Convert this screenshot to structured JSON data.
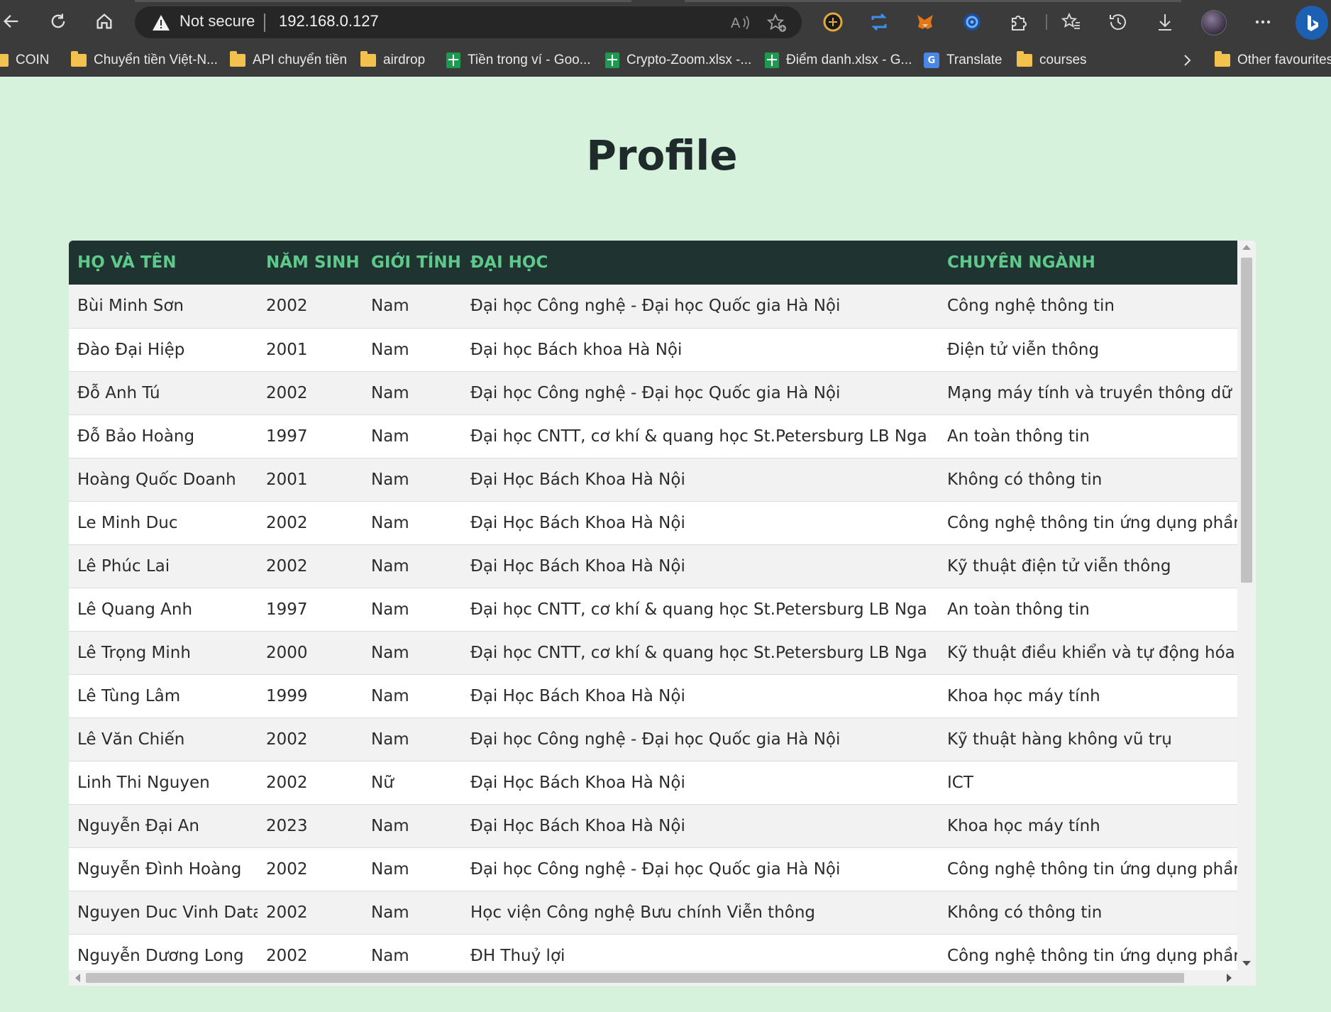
{
  "browser": {
    "security_label": "Not secure",
    "url": "192.168.0.127",
    "bookmarks": [
      {
        "label": "COIN",
        "icon": "folder-icon"
      },
      {
        "label": "Chuyển tiền Việt-N...",
        "icon": "folder-icon"
      },
      {
        "label": "API chuyển tiền",
        "icon": "folder-icon"
      },
      {
        "label": "airdrop",
        "icon": "folder-icon"
      },
      {
        "label": "Tiền trong ví - Goo...",
        "icon": "google-sheets-icon"
      },
      {
        "label": "Crypto-Zoom.xlsx -...",
        "icon": "google-sheets-icon"
      },
      {
        "label": "Điểm danh.xlsx - G...",
        "icon": "google-sheets-icon"
      },
      {
        "label": "Translate",
        "icon": "google-translate-icon"
      },
      {
        "label": "courses",
        "icon": "folder-icon"
      }
    ],
    "other_favourites_label": "Other favourites"
  },
  "page": {
    "title": "Profile"
  },
  "table": {
    "headers": [
      "HỌ VÀ TÊN",
      "NĂM SINH",
      "GIỚI TÍNH",
      "ĐẠI HỌC",
      "CHUYÊN NGÀNH"
    ],
    "rows": [
      [
        "Bùi Minh Sơn",
        "2002",
        "Nam",
        "Đại học Công nghệ - Đại học Quốc gia Hà Nội",
        "Công nghệ thông tin"
      ],
      [
        "Đào Đại Hiệp",
        "2001",
        "Nam",
        "Đại học Bách khoa Hà Nội",
        "Điện tử viễn thông"
      ],
      [
        "Đỗ Anh Tú",
        "2002",
        "Nam",
        "Đại học Công nghệ - Đại học Quốc gia Hà Nội",
        "Mạng máy tính và truyền thông dữ liệu"
      ],
      [
        "Đỗ Bảo Hoàng",
        "1997",
        "Nam",
        "Đại học CNTT, cơ khí & quang học St.Petersburg LB Nga",
        "An toàn thông tin"
      ],
      [
        "Hoàng Quốc Doanh",
        "2001",
        "Nam",
        "Đại Học Bách Khoa Hà Nội",
        "Không có thông tin"
      ],
      [
        "Le Minh Duc",
        "2002",
        "Nam",
        "Đại Học Bách Khoa Hà Nội",
        "Công nghệ thông tin ứng dụng phần mềm"
      ],
      [
        "Lê Phúc Lai",
        "2002",
        "Nam",
        "Đại Học Bách Khoa Hà Nội",
        "Kỹ thuật điện tử viễn thông"
      ],
      [
        "Lê Quang Anh",
        "1997",
        "Nam",
        "Đại học CNTT, cơ khí & quang học St.Petersburg LB Nga",
        "An toàn thông tin"
      ],
      [
        "Lê Trọng Minh",
        "2000",
        "Nam",
        "Đại học CNTT, cơ khí & quang học St.Petersburg LB Nga",
        "Kỹ thuật điều khiển và tự động hóa"
      ],
      [
        "Lê Tùng Lâm",
        "1999",
        "Nam",
        "Đại Học Bách Khoa Hà Nội",
        "Khoa học máy tính"
      ],
      [
        "Lê Văn Chiến",
        "2002",
        "Nam",
        "Đại học Công nghệ - Đại học Quốc gia Hà Nội",
        "Kỹ thuật hàng không vũ trụ"
      ],
      [
        "Linh Thi Nguyen",
        "2002",
        "Nữ",
        "Đại Học Bách Khoa Hà Nội",
        "ICT"
      ],
      [
        "Nguyễn Đại An",
        "2023",
        "Nam",
        "Đại Học Bách Khoa Hà Nội",
        "Khoa học máy tính"
      ],
      [
        "Nguyễn Đình Hoàng",
        "2002",
        "Nam",
        "Đại học Công nghệ - Đại học Quốc gia Hà Nội",
        "Công nghệ thông tin ứng dụng phần mềm"
      ],
      [
        "Nguyen Duc Vinh Data",
        "2002",
        "Nam",
        "Học viện Công nghệ Bưu chính Viễn thông",
        "Không có thông tin"
      ],
      [
        "Nguyễn Dương Long",
        "2002",
        "Nam",
        "ĐH Thuỷ lợi",
        "Công nghệ thông tin ứng dụng phần mềm"
      ]
    ]
  },
  "colors": {
    "page_background": "#d6f2dc",
    "header_background": "#1f3330",
    "header_text": "#5ec98a",
    "row_alt": "#f2f2f2"
  }
}
